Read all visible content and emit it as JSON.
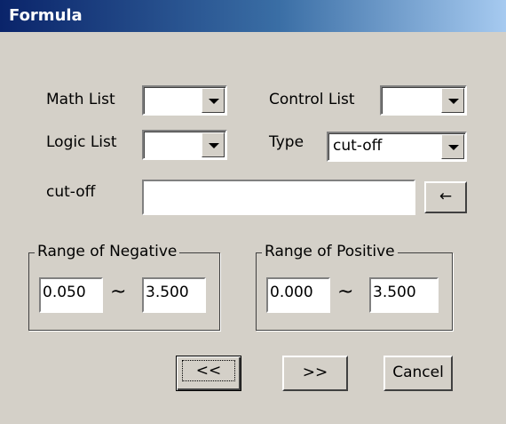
{
  "title": "Formula",
  "labels": {
    "math_list": "Math List",
    "control_list": "Control List",
    "logic_list": "Logic List",
    "type": "Type",
    "cutoff": "cut-off"
  },
  "fields": {
    "math_list_value": "",
    "control_list_value": "",
    "logic_list_value": "",
    "type_value": "cut-off",
    "cutoff_value": ""
  },
  "insert_button": "←",
  "range_negative": {
    "label": "Range of Negative",
    "min": "0.050",
    "sep": "~",
    "max": "3.500"
  },
  "range_positive": {
    "label": "Range of Positive",
    "min": "0.000",
    "sep": "~",
    "max": "3.500"
  },
  "buttons": {
    "prev": "<<",
    "next": ">>",
    "cancel": "Cancel"
  }
}
